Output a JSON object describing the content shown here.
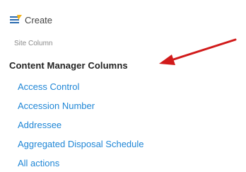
{
  "create": {
    "label": "Create",
    "icon": "create-column-icon"
  },
  "breadcrumb": {
    "site_column": "Site Column"
  },
  "group": {
    "heading": "Content Manager Columns"
  },
  "columns": [
    {
      "label": "Access Control"
    },
    {
      "label": "Accession Number"
    },
    {
      "label": "Addressee"
    },
    {
      "label": "Aggregated Disposal Schedule"
    },
    {
      "label": "All actions"
    }
  ],
  "annotation": {
    "arrow_icon": "red-arrow-icon",
    "color": "#d11a1a"
  },
  "colors": {
    "link": "#1f86d6",
    "heading": "#222222",
    "muted": "#8a8a8a"
  }
}
